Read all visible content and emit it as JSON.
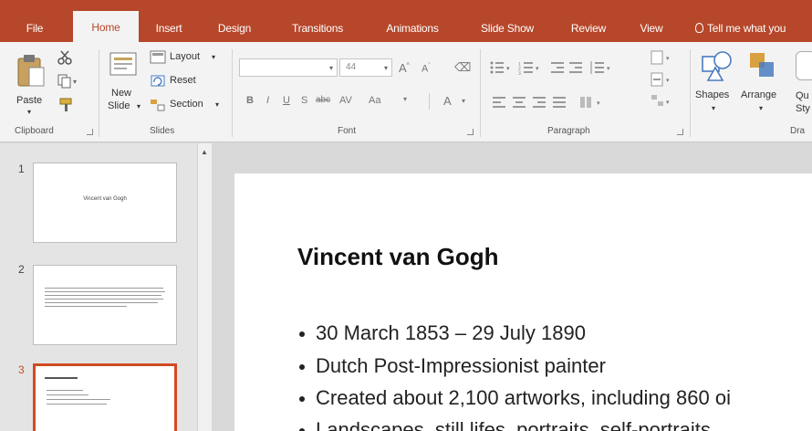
{
  "ribbon_tabs": [
    {
      "label": "File"
    },
    {
      "label": "Home"
    },
    {
      "label": "Insert"
    },
    {
      "label": "Design"
    },
    {
      "label": "Transitions"
    },
    {
      "label": "Animations"
    },
    {
      "label": "Slide Show"
    },
    {
      "label": "Review"
    },
    {
      "label": "View"
    },
    {
      "label": "Tell me what you"
    }
  ],
  "active_tab": "Home",
  "clipboard": {
    "paste_label": "Paste",
    "group_label": "Clipboard"
  },
  "slides_group": {
    "new_slide_line1": "New",
    "new_slide_line2": "Slide",
    "layout_label": "Layout",
    "reset_label": "Reset",
    "section_label": "Section",
    "group_label": "Slides"
  },
  "font_group": {
    "font_size": "44",
    "group_label": "Font"
  },
  "paragraph_group": {
    "group_label": "Paragraph"
  },
  "drawing_group": {
    "shapes_label": "Shapes",
    "arrange_label": "Arrange",
    "quick_styles_label": "Qu Sty",
    "group_label": "Dra"
  },
  "thumbnails": [
    {
      "number": "1",
      "caption": "Vincent van Gogh"
    },
    {
      "number": "2"
    },
    {
      "number": "3"
    }
  ],
  "slide": {
    "title": "Vincent van Gogh",
    "bullets": [
      "30 March 1853 – 29 July 1890",
      "Dutch Post-Impressionist painter",
      "Created about 2,100 artworks, including 860 oi",
      "Landscapes, still lifes, portraits, self-portraits"
    ]
  },
  "colors": {
    "accent": "#b7472a",
    "selected_thumb": "#d04a22"
  }
}
